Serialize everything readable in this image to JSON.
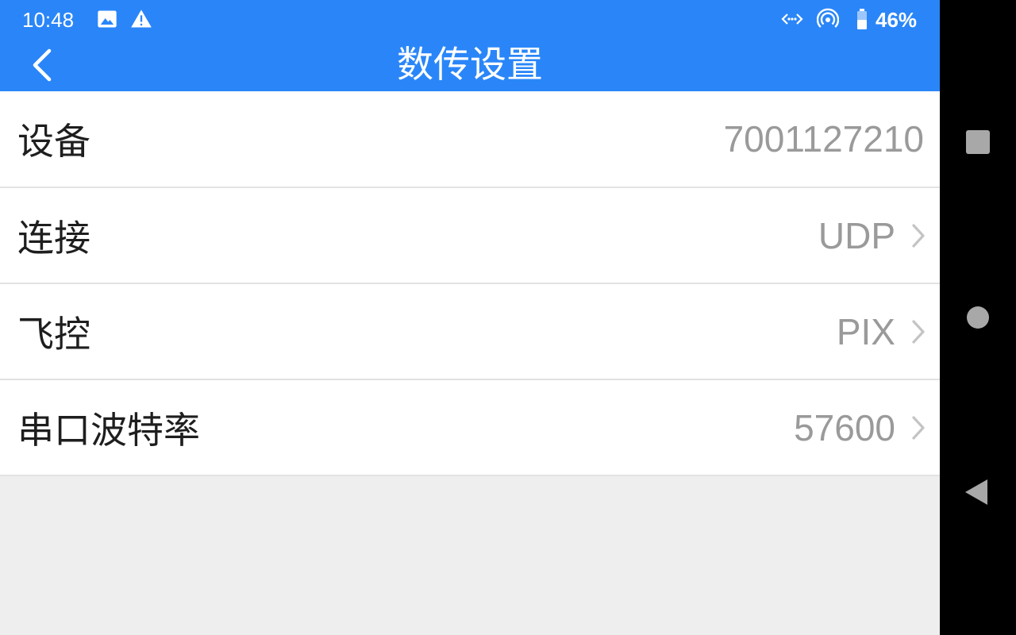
{
  "status_bar": {
    "time": "10:48",
    "battery_percent": "46%",
    "icons": [
      "image-icon",
      "warning-icon",
      "data-sync-icon",
      "hotspot-icon",
      "battery-icon"
    ]
  },
  "app_bar": {
    "title": "数传设置",
    "back_icon": "chevron-left-icon"
  },
  "settings": [
    {
      "label": "设备",
      "value": "7001127210",
      "has_chevron": false
    },
    {
      "label": "连接",
      "value": "UDP",
      "has_chevron": true
    },
    {
      "label": "飞控",
      "value": "PIX",
      "has_chevron": true
    },
    {
      "label": "串口波特率",
      "value": "57600",
      "has_chevron": true
    }
  ],
  "nav_bar": {
    "buttons": [
      "recents-button",
      "home-button",
      "back-button"
    ]
  },
  "colors": {
    "app_bar": "#2a86f8",
    "background": "#eeeeee",
    "value_text": "#9a9a9a",
    "label_text": "#1e1e1e"
  }
}
